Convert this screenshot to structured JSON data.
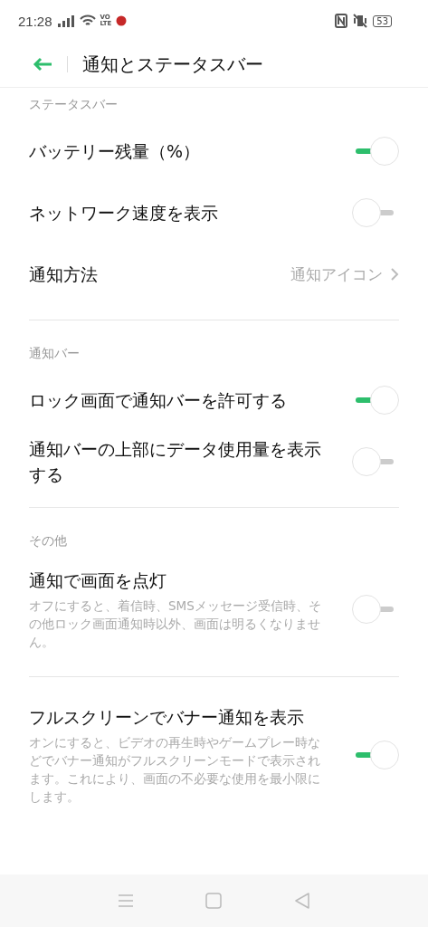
{
  "status_bar": {
    "time": "21:28",
    "volte_top": "VO",
    "volte_bottom": "LTE",
    "battery": "53"
  },
  "header": {
    "title": "通知とステータスバー"
  },
  "sections": [
    {
      "title": "ステータスバー",
      "items": [
        {
          "kind": "switch",
          "label": "バッテリー残量（%）",
          "on": true
        },
        {
          "kind": "switch",
          "label": "ネットワーク速度を表示",
          "on": false
        },
        {
          "kind": "value",
          "label": "通知方法",
          "value": "通知アイコン"
        }
      ]
    },
    {
      "title": "通知バー",
      "items": [
        {
          "kind": "switch",
          "label": "ロック画面で通知バーを許可する",
          "on": true
        },
        {
          "kind": "switch",
          "label": "通知バーの上部にデータ使用量を表示する",
          "on": false
        }
      ]
    },
    {
      "title": "その他",
      "items": [
        {
          "kind": "switch",
          "label": "通知で画面を点灯",
          "description": "オフにすると、着信時、SMSメッセージ受信時、その他ロック画面通知時以外、画面は明るくなりません。",
          "on": false
        }
      ]
    },
    {
      "items": [
        {
          "kind": "switch",
          "label": "フルスクリーンでバナー通知を表示",
          "description": "オンにすると、ビデオの再生時やゲームプレー時などでバナー通知がフルスクリーンモードで表示されます。これにより、画面の不必要な使用を最小限にします。",
          "on": true
        }
      ]
    }
  ]
}
